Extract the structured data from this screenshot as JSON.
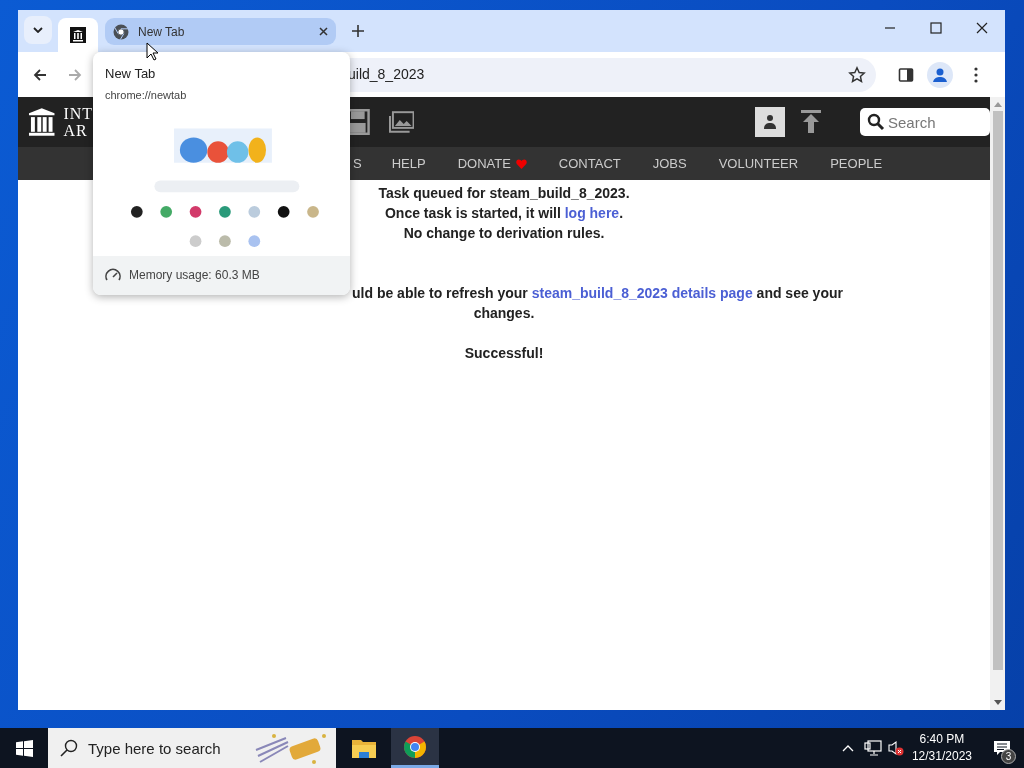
{
  "browser": {
    "tabs": [
      {
        "kind": "pinned",
        "selected": true
      },
      {
        "kind": "normal",
        "label": "New Tab",
        "selected": false,
        "hovered": true
      }
    ],
    "address": {
      "value": "uild_8_2023"
    }
  },
  "hover_card": {
    "title": "New Tab",
    "url": "chrome://newtab",
    "memory": "Memory usage: 60.3 MB"
  },
  "site": {
    "logo_lines": [
      "INT",
      "AR"
    ],
    "search": {
      "placeholder": "Search"
    },
    "nav": [
      {
        "label": "S",
        "heart": false
      },
      {
        "label": "HELP",
        "heart": false
      },
      {
        "label": "DONATE",
        "heart": true
      },
      {
        "label": "CONTACT",
        "heart": false
      },
      {
        "label": "JOBS",
        "heart": false
      },
      {
        "label": "VOLUNTEER",
        "heart": false
      },
      {
        "label": "PEOPLE",
        "heart": false
      }
    ]
  },
  "messages": [
    {
      "kind": "line",
      "parts": [
        {
          "text": "Task queued for steam_build_8_2023."
        }
      ]
    },
    {
      "kind": "line",
      "parts": [
        {
          "text": "Once task is started, it will "
        },
        {
          "text": "log here",
          "link": true
        },
        {
          "text": "."
        }
      ]
    },
    {
      "kind": "line",
      "parts": [
        {
          "text": "No change to derivation rules."
        }
      ]
    },
    {
      "kind": "gap"
    },
    {
      "kind": "gap"
    },
    {
      "kind": "cut",
      "parts": [
        {
          "text": "uld be able to refresh your "
        },
        {
          "text": "steam_build_8_2023 details page",
          "link": true
        },
        {
          "text": " and see your"
        }
      ]
    },
    {
      "kind": "line",
      "parts": [
        {
          "text": "changes."
        }
      ]
    },
    {
      "kind": "gap"
    },
    {
      "kind": "line",
      "parts": [
        {
          "text": "Successful!"
        }
      ]
    }
  ],
  "taskbar": {
    "search_placeholder": "Type here to search",
    "apps": [
      {
        "kind": "explorer",
        "selected": false
      },
      {
        "kind": "chrome",
        "selected": true
      }
    ],
    "time": "6:40 PM",
    "date": "12/31/2023",
    "notifications": "3"
  }
}
